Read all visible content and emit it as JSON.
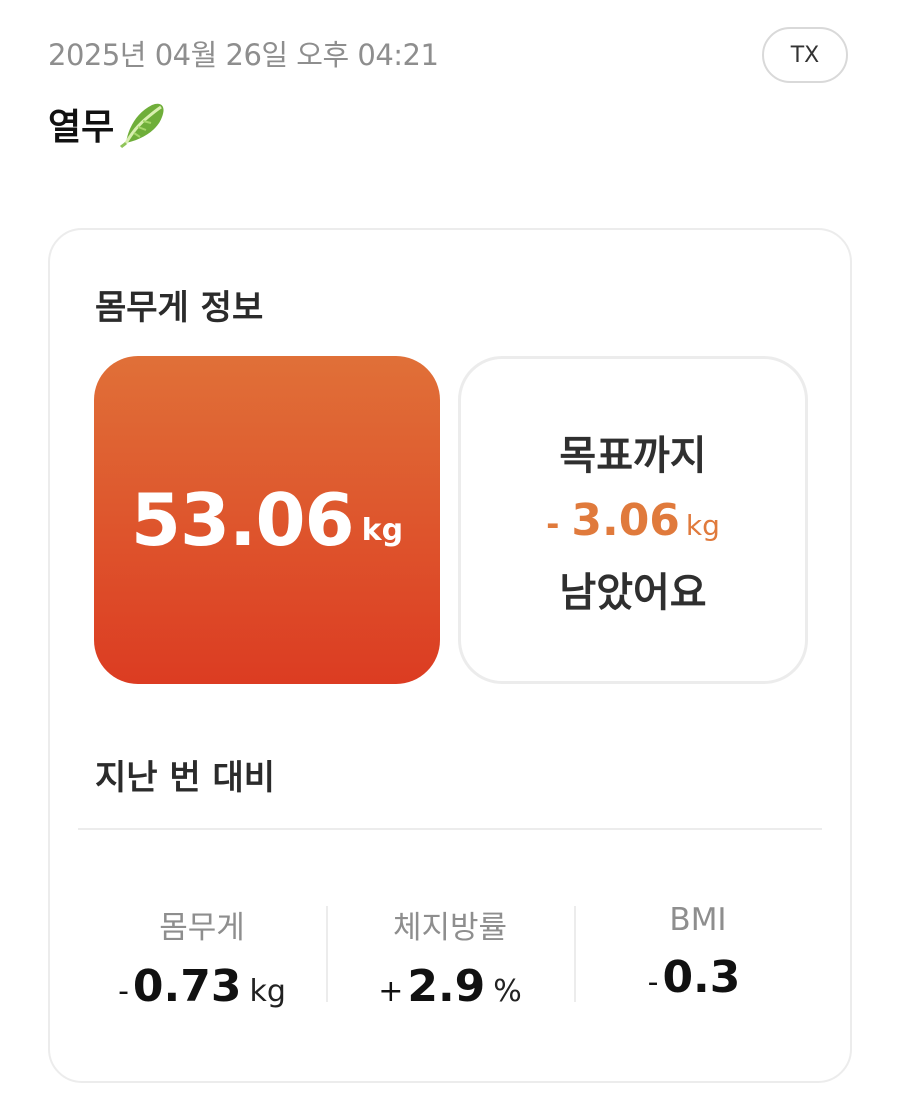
{
  "header": {
    "timestamp": "2025년 04월 26일 오후 04:21",
    "tx_label": "TX",
    "title": "열무",
    "title_icon": "lettuce-icon"
  },
  "weight_info": {
    "section_title": "몸무게 정보",
    "current_weight": "53.06",
    "current_unit": "kg",
    "goal_label": "목표까지",
    "goal_sign": "-",
    "goal_value": "3.06",
    "goal_unit": "kg",
    "goal_suffix": "남았어요"
  },
  "comparison": {
    "section_title": "지난 번 대비",
    "stats": [
      {
        "label": "몸무게",
        "sign": "-",
        "value": "0.73",
        "unit": "kg"
      },
      {
        "label": "체지방률",
        "sign": "+",
        "value": "2.9",
        "unit": "%"
      },
      {
        "label": "BMI",
        "sign": "-",
        "value": "0.3",
        "unit": ""
      }
    ]
  },
  "colors": {
    "accent_orange": "#e07a3c",
    "tile_gradient_top": "#e07038",
    "tile_gradient_bottom": "#dc3c22"
  }
}
